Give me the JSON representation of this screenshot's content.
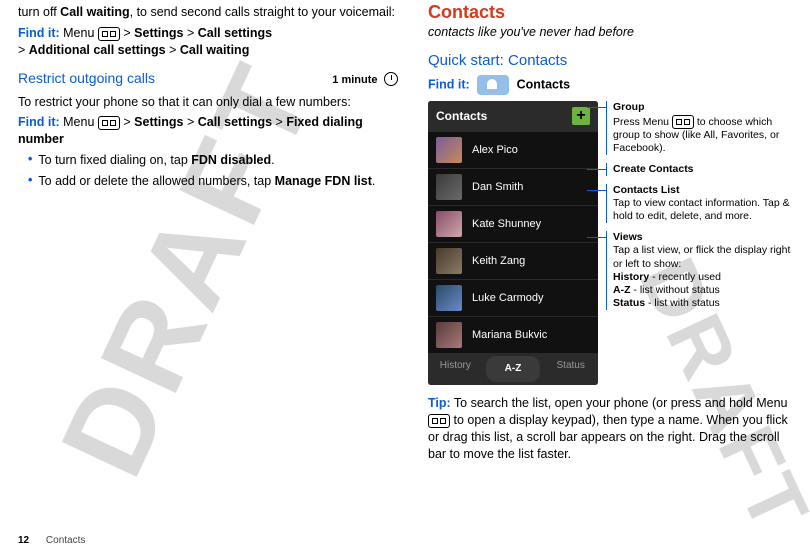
{
  "left": {
    "intro": "turn off ",
    "intro_bold": "Call waiting",
    "intro_cont": ", to send second calls straight to your voicemail:",
    "findit_path": [
      "Menu",
      "Settings",
      "Call settings",
      "Additional call settings",
      "Call waiting"
    ],
    "restrict_title": "Restrict outgoing calls",
    "restrict_duration": "1 minute",
    "restrict_body": "To restrict your phone so that it can only dial a few numbers:",
    "restrict_findit_path": [
      "Menu",
      "Settings",
      "Call settings",
      "Fixed dialing number"
    ],
    "bullet1_pre": "To turn fixed dialing on, tap ",
    "bullet1_bold": "FDN disabled",
    "bullet1_post": ".",
    "bullet2_pre": "To add or delete the allowed numbers, tap ",
    "bullet2_bold": "Manage FDN list",
    "bullet2_post": "."
  },
  "right": {
    "heading": "Contacts",
    "subheading": "contacts like you've never had before",
    "quickstart": "Quick start: Contacts",
    "findit_label": "Find it:",
    "findit_target": "Contacts",
    "phone": {
      "header": "Contacts",
      "rows": [
        "Alex Pico",
        "Dan Smith",
        "Kate Shunney",
        "Keith Zang",
        "Luke Carmody",
        "Mariana Bukvic"
      ],
      "tabs": [
        "History",
        "A-Z",
        "Status"
      ]
    },
    "annos": {
      "group": {
        "title": "Group",
        "body_pre": "Press Menu ",
        "body_post": " to choose which group to show (like All, Favorites, or Facebook)."
      },
      "create": {
        "title": "Create Contacts"
      },
      "list": {
        "title": "Contacts  List",
        "body": "Tap to view contact information. Tap & hold to edit, delete, and more."
      },
      "views": {
        "title": "Views",
        "body": "Tap a list view, or flick the display right or left to show:",
        "hist_b": "History",
        "hist_t": " - recently used",
        "az_b": "A-Z",
        "az_t": " - list without status",
        "st_b": "Status",
        "st_t": " - list with status"
      }
    },
    "tip_label": "Tip:",
    "tip_body_pre": " To search the list, open your phone (or press and hold Menu ",
    "tip_body_post": " to open a display keypad), then type a name. When you flick or drag this list, a scroll bar appears on the right. Drag the scroll bar to move the list faster."
  },
  "footer": {
    "page": "12",
    "section": "Contacts"
  }
}
